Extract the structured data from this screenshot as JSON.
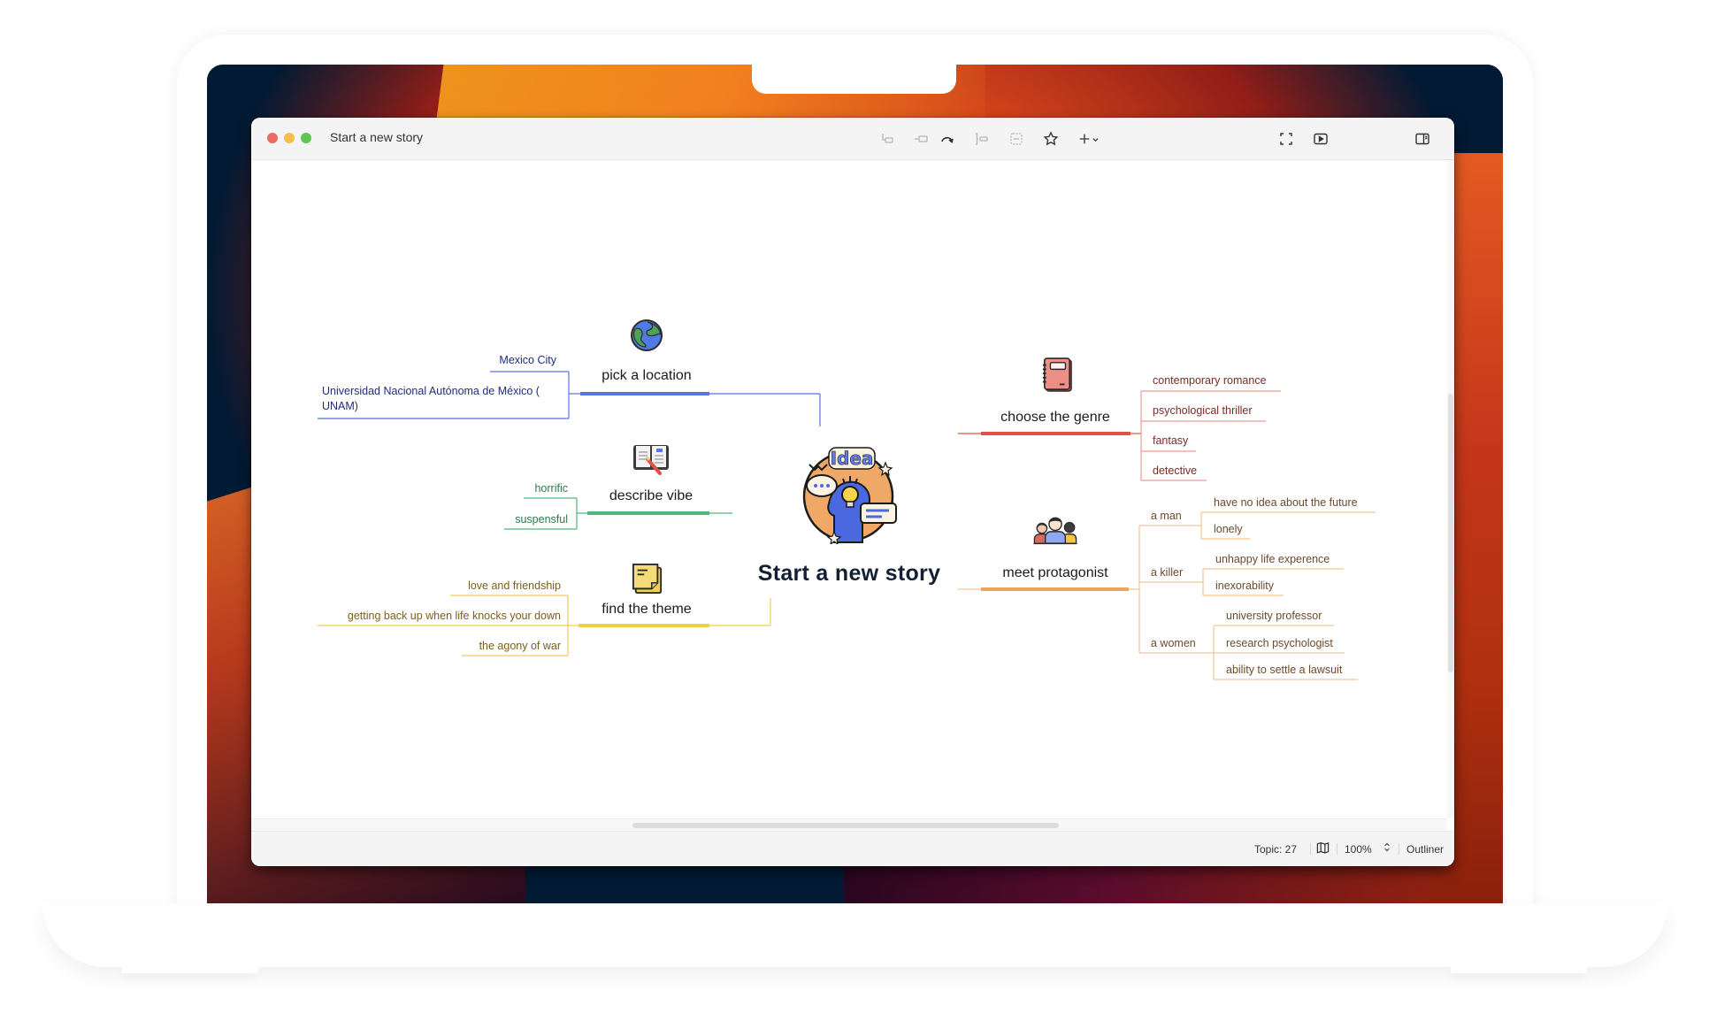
{
  "window": {
    "title": "Start a new story",
    "toolbar": [
      {
        "name": "subtopic-icon",
        "enabled": false
      },
      {
        "name": "insert-topic-icon",
        "enabled": false
      },
      {
        "name": "relationship-icon",
        "enabled": true
      },
      {
        "name": "summary-icon",
        "enabled": false
      },
      {
        "name": "boundary-icon",
        "enabled": false
      },
      {
        "name": "star-icon",
        "enabled": true
      },
      {
        "name": "add-icon",
        "enabled": true
      }
    ],
    "right_toolbar": [
      "fullscreen-icon",
      "presentation-icon",
      "sidebar-toggle-icon"
    ]
  },
  "mindmap": {
    "central": {
      "label": "Start a new story",
      "icon": "idea-lightbulb-icon"
    },
    "branches": {
      "location": {
        "label": "pick a location",
        "icon": "globe-icon",
        "color": "#5b72e6",
        "children": [
          "Mexico City",
          "Universidad Nacional Autónoma de México (",
          "UNAM)"
        ]
      },
      "vibe": {
        "label": "describe vibe",
        "icon": "book-pencil-icon",
        "color": "#4fb87a",
        "children": [
          "horrific",
          "suspensful"
        ]
      },
      "theme": {
        "label": "find the theme",
        "icon": "sticky-note-icon",
        "color": "#f2cd4c",
        "children": [
          "love and friendship",
          "getting back up when life knocks your down",
          "the agony of war"
        ]
      },
      "genre": {
        "label": "choose the genre",
        "icon": "notebook-icon",
        "color": "#e55245",
        "children": [
          "contemporary romance",
          "psychological thriller",
          "fantasy",
          "detective"
        ]
      },
      "protagonist": {
        "label": "meet protagonist",
        "icon": "people-group-icon",
        "color": "#eda35a",
        "children": [
          {
            "label": "a  man",
            "children": [
              "have no idea about the future",
              "lonely"
            ]
          },
          {
            "label": "a  killer",
            "children": [
              "unhappy life experence",
              "inexorability"
            ]
          },
          {
            "label": "a women",
            "children": [
              "university professor",
              "research psychologist",
              "ability to settle a lawsuit"
            ]
          }
        ]
      }
    }
  },
  "statusbar": {
    "topic_count": "Topic: 27",
    "zoom": "100%",
    "outliner": "Outliner"
  }
}
